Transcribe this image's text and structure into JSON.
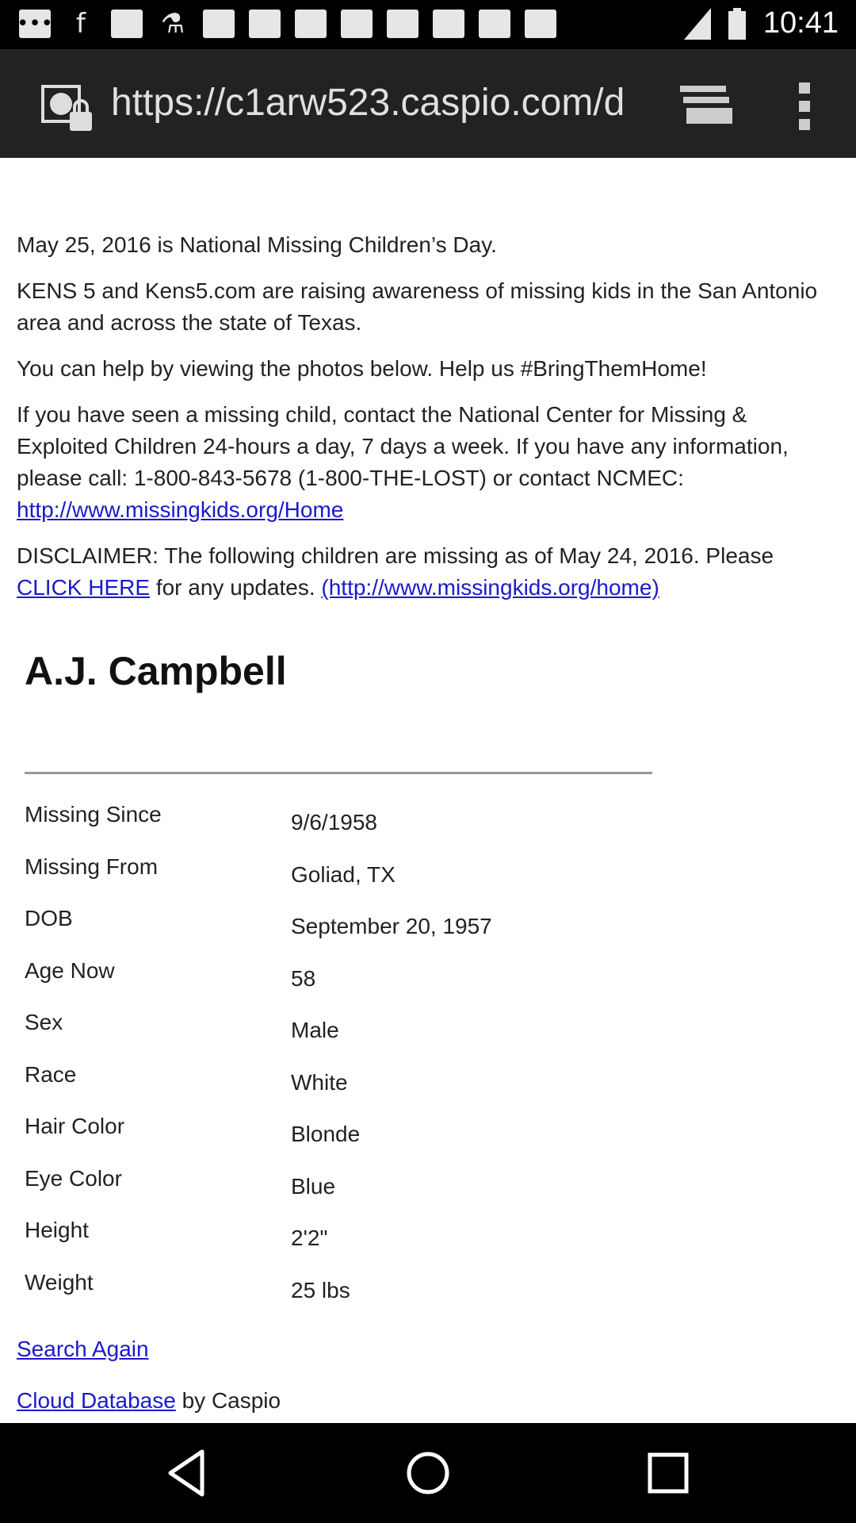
{
  "status_bar": {
    "time": "10:41",
    "left_icons": [
      "message-icon",
      "facebook-icon",
      "image-icon",
      "microscope-icon",
      "image-icon",
      "image-icon",
      "image-icon",
      "image-icon",
      "image-icon",
      "image-icon",
      "image-icon",
      "image-icon"
    ],
    "right_icons": [
      "signal-icon",
      "battery-icon"
    ]
  },
  "browser": {
    "url": "https://c1arw523.caspio.com/d",
    "tabs_icon": "tabs-icon",
    "menu_icon": "overflow-menu-icon"
  },
  "intro": {
    "p1": "May 25, 2016 is National Missing Children’s Day.",
    "p2": "KENS 5 and Kens5.com are raising awareness of missing kids in the San Antonio area and across the state of Texas.",
    "p3": "You can help by viewing the photos below. Help us #BringThemHome!",
    "p4_text": "If you have seen a missing child, contact the National Center for Missing & Exploited Children 24-hours a day, 7 days a week. If you have any information, please call: 1-800-843-5678 (1-800-THE-LOST) or contact NCMEC: ",
    "p4_link": "http://www.missingkids.org/Home",
    "p5_text1": "DISCLAIMER: The following children are missing as of May 24, 2016. Please ",
    "p5_link1": "CLICK HERE",
    "p5_text2": " for any updates. ",
    "p5_link2": "(http://www.missingkids.org/home)"
  },
  "person": {
    "name": "A.J. Campbell",
    "fields": [
      {
        "label": "Missing Since",
        "value": "9/6/1958"
      },
      {
        "label": "Missing From",
        "value": "Goliad, TX"
      },
      {
        "label": "DOB",
        "value": "September 20, 1957"
      },
      {
        "label": "Age Now",
        "value": "58"
      },
      {
        "label": "Sex",
        "value": "Male"
      },
      {
        "label": "Race",
        "value": "White"
      },
      {
        "label": "Hair Color",
        "value": "Blonde"
      },
      {
        "label": "Eye Color",
        "value": "Blue"
      },
      {
        "label": "Height",
        "value": "2'2\""
      },
      {
        "label": "Weight",
        "value": "25 lbs"
      }
    ]
  },
  "footer": {
    "search_again": "Search Again",
    "cloud_db": "Cloud Database",
    "by_caspio": " by Caspio"
  },
  "nav": {
    "back": "back-icon",
    "home": "home-icon",
    "recents": "recents-icon"
  }
}
